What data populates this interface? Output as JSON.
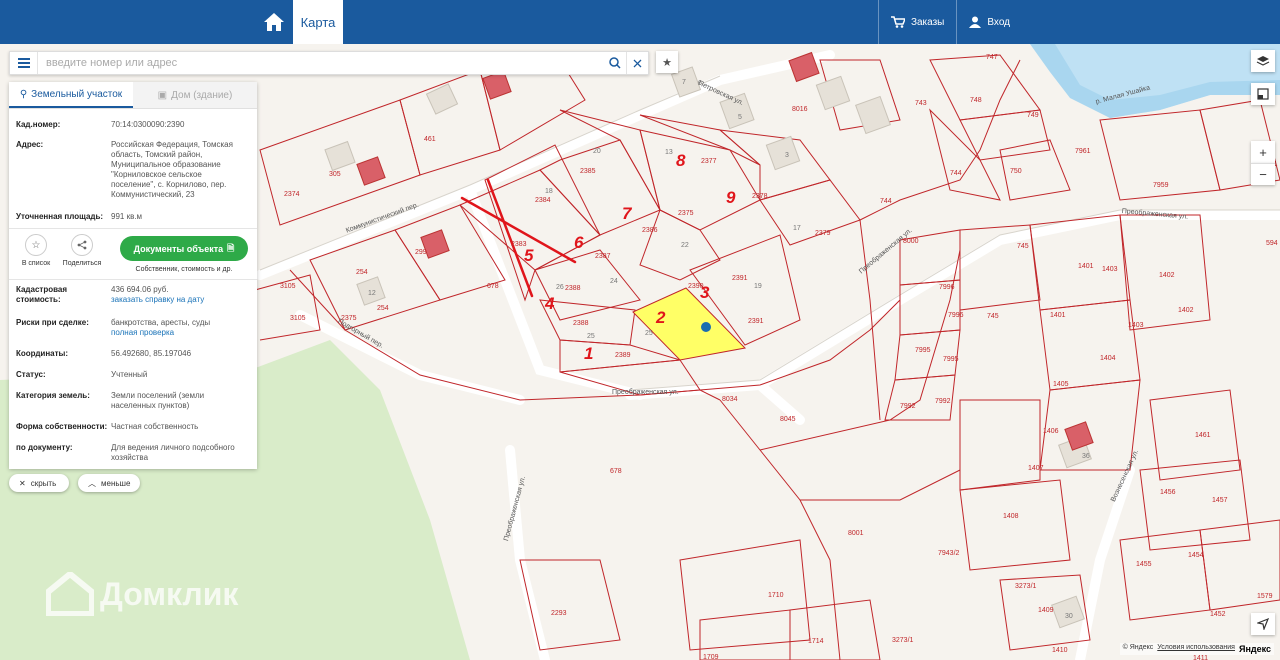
{
  "header": {
    "tab_map": "Карта",
    "orders": "Заказы",
    "login": "Вход"
  },
  "search": {
    "placeholder": "введите номер или адрес"
  },
  "panel": {
    "tab_land": "Земельный участок",
    "tab_house": "Дом (здание)",
    "rows": [
      {
        "label": "Кад.номер:",
        "value": "70:14:0300090:2390"
      },
      {
        "label": "Адрес:",
        "value": "Российская Федерация, Томская область, Томский район, Муниципальное образование \"Корниловское сельское поселение\", с. Корнилово, пер. Коммунистический, 23"
      },
      {
        "label": "Уточненная площадь:",
        "value": "991 кв.м"
      }
    ],
    "actions": {
      "favorite": "В список",
      "share": "Поделиться",
      "documents": "Документы объекта",
      "documents_sub": "Собственник, стоимость и др."
    },
    "cadastral_label": "Кадастровая стоимость:",
    "cadastral_value": "436 694.06 руб.",
    "cadastral_link": "заказать справку на дату",
    "risk_label": "Риски при сделке:",
    "risk_value": "банкротства, аресты, суды",
    "risk_link": "полная проверка",
    "coords_label": "Координаты:",
    "coords_value": "56.492680, 85.197046",
    "status_label": "Статус:",
    "status_value": "Учтенный",
    "category_label": "Категория земель:",
    "category_value": "Земли поселений (земли населенных пунктов)",
    "ownership_label": "Форма собственности:",
    "ownership_value": "Частная собственность",
    "document_label": "по документу:",
    "document_value": "Для ведения личного подсобного хозяйства"
  },
  "pills": {
    "hide": "скрыть",
    "less": "меньше"
  },
  "map": {
    "parcels": [
      "2390",
      "2391",
      "2391",
      "2389",
      "2388",
      "2388",
      "2387",
      "2386",
      "2385",
      "2384",
      "2383",
      "2375",
      "2377",
      "2378",
      "2379",
      "8000",
      "7996",
      "7996",
      "7995",
      "7995",
      "7992",
      "7992",
      "745",
      "745",
      "744",
      "744",
      "743",
      "748",
      "749",
      "750",
      "747",
      "7961",
      "7961",
      "7959",
      "1401",
      "1401",
      "1402",
      "1402",
      "1403",
      "1403",
      "1404",
      "1405",
      "1406",
      "1407",
      "1408",
      "1461",
      "1456",
      "1457",
      "1455",
      "1454",
      "1452",
      "1409",
      "1410",
      "1411",
      "1710",
      "1709",
      "1714",
      "2293",
      "678",
      "678",
      "8034",
      "8045",
      "8001",
      "7943/2",
      "3273/1",
      "3273/1",
      "8016",
      "2374",
      "305",
      "461",
      "299",
      "254",
      "254",
      "3105",
      "3105",
      "2375",
      "1579",
      "594"
    ],
    "house_numbers": [
      "20",
      "18",
      "13",
      "26",
      "25",
      "24",
      "22",
      "17",
      "12",
      "19",
      "36",
      "30",
      "6",
      "3",
      "5",
      "7",
      "25"
    ],
    "streets": [
      "Петровская ул.",
      "Преображенская ул.",
      "Коммунистический пер.",
      "Подгорный пер.",
      "Преображенская ул.",
      "Преображенская ул.",
      "Преображенская ул.",
      "Вознесенская ул.",
      "р. Малая Ушайка"
    ],
    "handwritten": [
      "1",
      "2",
      "3",
      "4",
      "5",
      "6",
      "7",
      "8",
      "9"
    ],
    "colors": {
      "highlight": "#ffff66",
      "parcel_line": "#c0262a",
      "forest": "#d9ecc9",
      "water": "#bfe1f4"
    }
  },
  "watermark": "Домклик",
  "attribution": {
    "copyright": "© Яндекс",
    "terms": "Условия использования",
    "brand": "Яндекс"
  }
}
